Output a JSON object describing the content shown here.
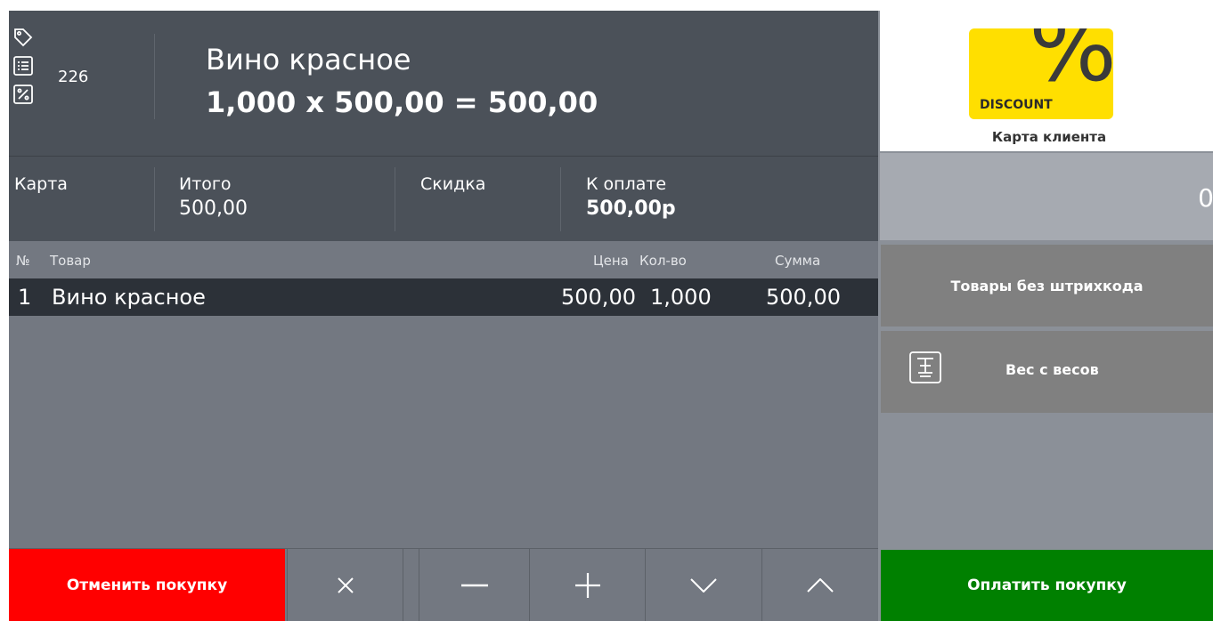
{
  "header": {
    "doc_number": "226",
    "item_name": "Вино красное",
    "item_calc": "1,000 x 500,00 = 500,00"
  },
  "totals": {
    "card_label": "Карта",
    "total_label": "Итого",
    "total_value": "500,00",
    "discount_label": "Скидка",
    "pay_label": "К оплате",
    "pay_value": "500,00р"
  },
  "table": {
    "columns": {
      "num": "№",
      "item": "Товар",
      "price": "Цена",
      "qty": "Кол-во",
      "sum": "Сумма"
    },
    "rows": [
      {
        "num": "1",
        "item": "Вино красное",
        "price": "500,00",
        "qty": "1,000",
        "sum": "500,00"
      }
    ]
  },
  "bottom": {
    "cancel_label": "Отменить покупку"
  },
  "side": {
    "discount_card_text": "DISCOUNT",
    "discount_card_symbol": "%",
    "card_label": "Карта клиента",
    "counter_value": "0",
    "no_barcode_label": "Товары без штрихкода",
    "weight_label": "Вес с весов",
    "pay_label": "Оплатить покупку"
  },
  "colors": {
    "cancel": "#ff0000",
    "pay": "#008000",
    "discount_card": "#ffdf00",
    "dark_panel": "#4b5159",
    "selected_row": "#2c3138"
  }
}
